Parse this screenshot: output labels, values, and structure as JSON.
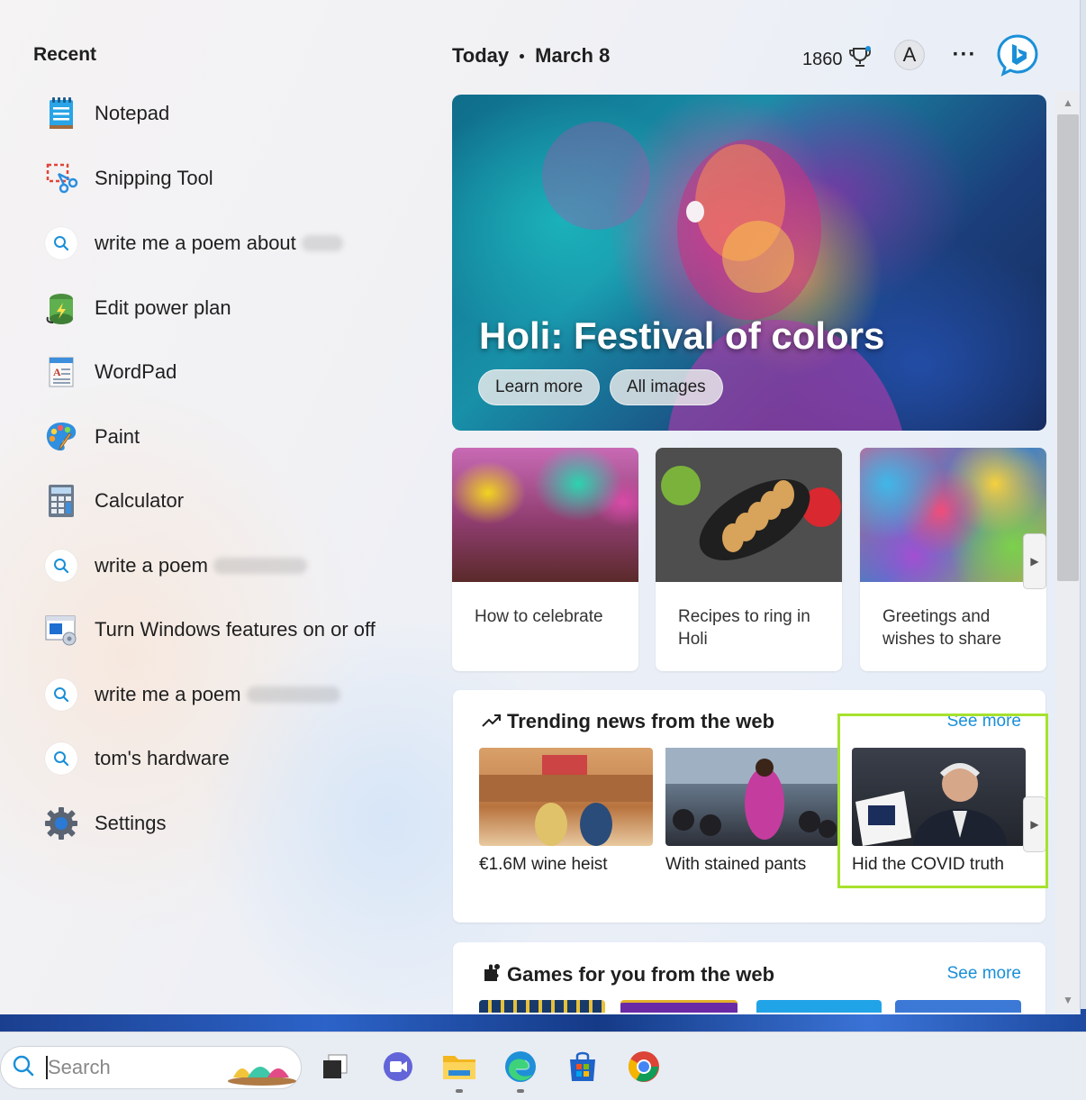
{
  "recent": {
    "title": "Recent",
    "items": [
      {
        "label": "Notepad",
        "icon": "notepad-icon"
      },
      {
        "label": "Snipping Tool",
        "icon": "snipping-tool-icon"
      },
      {
        "label": "write me a poem about",
        "icon": "search-icon"
      },
      {
        "label": "Edit power plan",
        "icon": "power-plan-icon"
      },
      {
        "label": "WordPad",
        "icon": "wordpad-icon"
      },
      {
        "label": "Paint",
        "icon": "paint-icon"
      },
      {
        "label": "Calculator",
        "icon": "calculator-icon"
      },
      {
        "label": "write a poem",
        "icon": "search-icon"
      },
      {
        "label": "Turn Windows features on or off",
        "icon": "windows-features-icon"
      },
      {
        "label": "write me a poem",
        "icon": "search-icon"
      },
      {
        "label": "tom's hardware",
        "icon": "search-icon"
      },
      {
        "label": "Settings",
        "icon": "settings-icon"
      }
    ]
  },
  "header": {
    "today": "Today",
    "date": "March 8",
    "points": "1860",
    "avatar_initial": "A",
    "more": "···"
  },
  "hero": {
    "title": "Holi: Festival of colors",
    "learn_more": "Learn more",
    "all_images": "All images"
  },
  "cards": [
    {
      "caption": "How to celebrate"
    },
    {
      "caption": "Recipes to ring in Holi"
    },
    {
      "caption": "Greetings and wishes to share"
    }
  ],
  "trending": {
    "title": "Trending news from the web",
    "see_more": "See more",
    "items": [
      {
        "caption": "€1.6M wine heist"
      },
      {
        "caption": "With stained pants"
      },
      {
        "caption": "Hid the COVID truth"
      }
    ]
  },
  "games": {
    "title": "Games for you from the web",
    "see_more": "See more"
  },
  "taskbar": {
    "search_placeholder": "Search"
  },
  "colors": {
    "accent": "#1a8fd8",
    "highlight": "#a6e22e"
  }
}
